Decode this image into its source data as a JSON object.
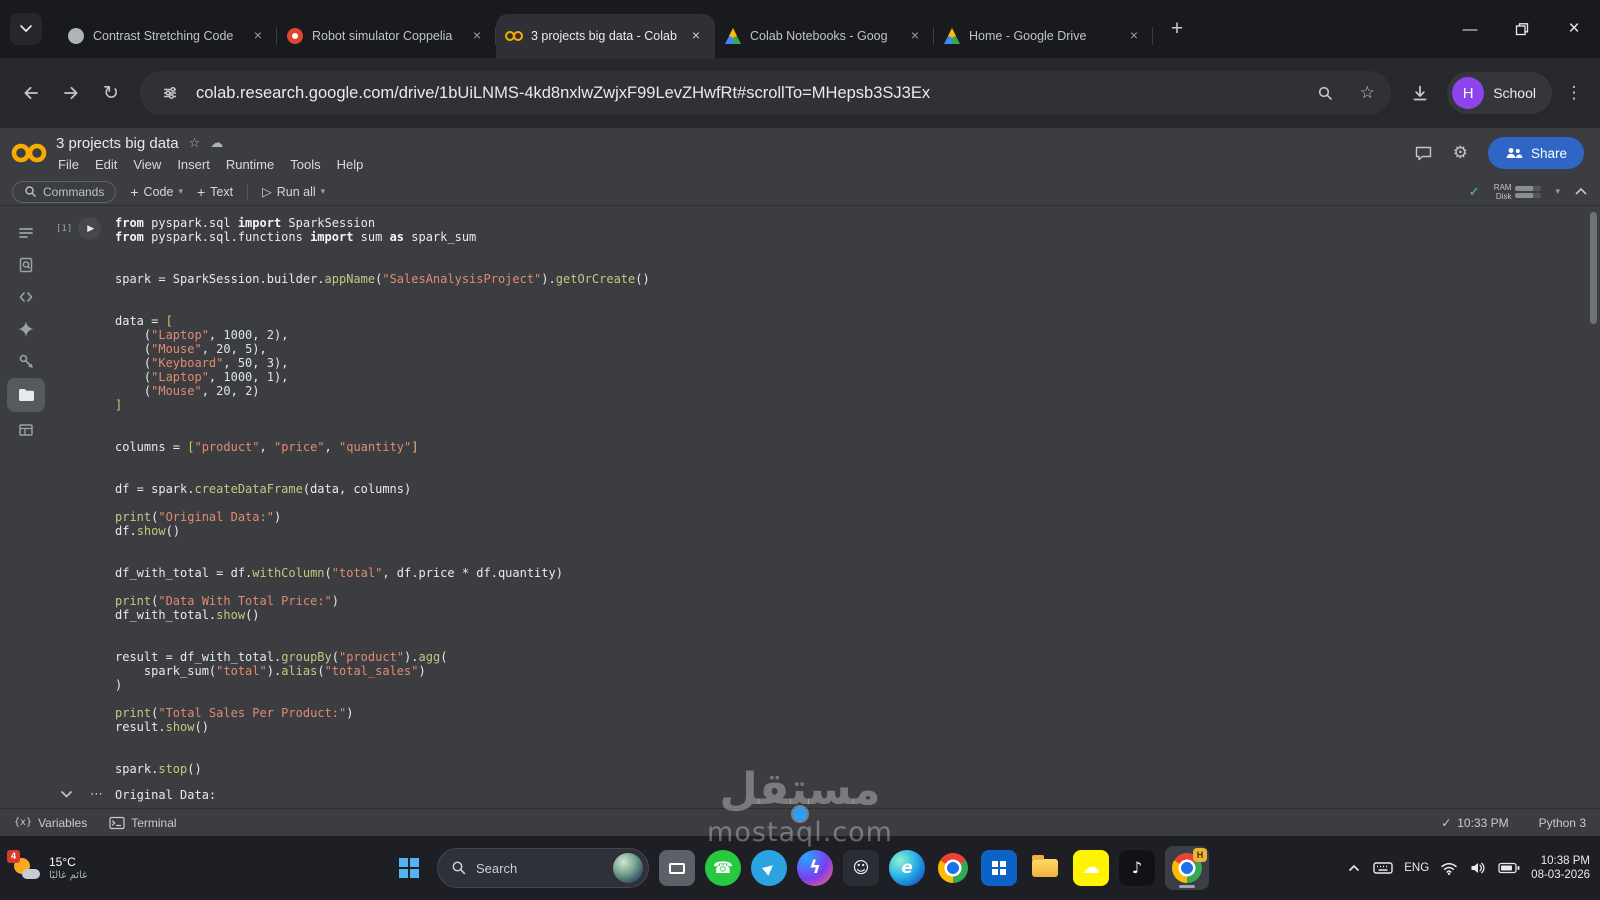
{
  "browser": {
    "tabs": [
      {
        "title": "Contrast Stretching Code",
        "icon": "page"
      },
      {
        "title": "Robot simulator Coppelia",
        "icon": "robot"
      },
      {
        "title": "3 projects big data - Colab",
        "icon": "colab",
        "active": true
      },
      {
        "title": "Colab Notebooks - Goog",
        "icon": "drive"
      },
      {
        "title": "Home - Google Drive",
        "icon": "drive"
      }
    ],
    "url": "colab.research.google.com/drive/1bUiLNMS-4kd8nxlwZwjxF99LevZHwfRt#scrollTo=MHepsb3SJ3Ex",
    "profile": {
      "initial": "H",
      "name": "School",
      "color": "#8e44ec"
    }
  },
  "colab": {
    "title": "3 projects big data",
    "menu": [
      "File",
      "Edit",
      "View",
      "Insert",
      "Runtime",
      "Tools",
      "Help"
    ],
    "toolbar": {
      "commands": "Commands",
      "add_code": "Code",
      "add_text": "Text",
      "run_all": "Run all",
      "ram": "RAM",
      "disk": "Disk"
    },
    "share_label": "Share",
    "share_color": "#2f66c5",
    "rail": [
      {
        "name": "table-of-contents"
      },
      {
        "name": "find-replace"
      },
      {
        "name": "code-snippets"
      },
      {
        "name": "gemini"
      },
      {
        "name": "secrets"
      },
      {
        "name": "files",
        "active": true
      },
      {
        "name": "data-table"
      }
    ],
    "cell": {
      "exec_count": "[1]",
      "code_lines": [
        "from pyspark.sql import SparkSession",
        "from pyspark.sql.functions import sum as spark_sum",
        "",
        "",
        "spark = SparkSession.builder.appName(\"SalesAnalysisProject\").getOrCreate()",
        "",
        "",
        "data = [",
        "    (\"Laptop\", 1000, 2),",
        "    (\"Mouse\", 20, 5),",
        "    (\"Keyboard\", 50, 3),",
        "    (\"Laptop\", 1000, 1),",
        "    (\"Mouse\", 20, 2)",
        "]",
        "",
        "",
        "columns = [\"product\", \"price\", \"quantity\"]",
        "",
        "",
        "df = spark.createDataFrame(data, columns)",
        "",
        "print(\"Original Data:\")",
        "df.show()",
        "",
        "",
        "df_with_total = df.withColumn(\"total\", df.price * df.quantity)",
        "",
        "print(\"Data With Total Price:\")",
        "df_with_total.show()",
        "",
        "",
        "result = df_with_total.groupBy(\"product\").agg(",
        "    spark_sum(\"total\").alias(\"total_sales\")",
        ")",
        "",
        "print(\"Total Sales Per Product:\")",
        "result.show()",
        "",
        "",
        "spark.stop()"
      ],
      "output_lines": [
        "Original Data:"
      ]
    },
    "statusbar": {
      "variables": "Variables",
      "terminal": "Terminal",
      "time": "10:33 PM",
      "kernel": "Python 3"
    }
  },
  "watermark": {
    "word": "مستقل",
    "domain": "mostaql.com",
    "accent": "#2e9df6"
  },
  "taskbar": {
    "weather": {
      "temp": "15°C",
      "condition": "غائم غالبًا",
      "badge": "4"
    },
    "search_label": "Search",
    "apps": [
      {
        "name": "pinned-window"
      },
      {
        "name": "whatsapp",
        "glyph": "☎"
      },
      {
        "name": "telegram",
        "glyph": "▶"
      },
      {
        "name": "messenger",
        "glyph": "ϟ"
      },
      {
        "name": "discord",
        "glyph": "☺"
      },
      {
        "name": "edge",
        "glyph": "e"
      },
      {
        "name": "chrome"
      },
      {
        "name": "microsoft-store"
      },
      {
        "name": "file-explorer"
      },
      {
        "name": "snapchat",
        "glyph": "☁"
      },
      {
        "name": "tiktok",
        "glyph": "♪"
      },
      {
        "name": "chrome-profile",
        "active": true,
        "badge": "H"
      }
    ],
    "tray": {
      "language": "ENG",
      "time": "10:38 PM",
      "date": "08-03-2026"
    }
  }
}
